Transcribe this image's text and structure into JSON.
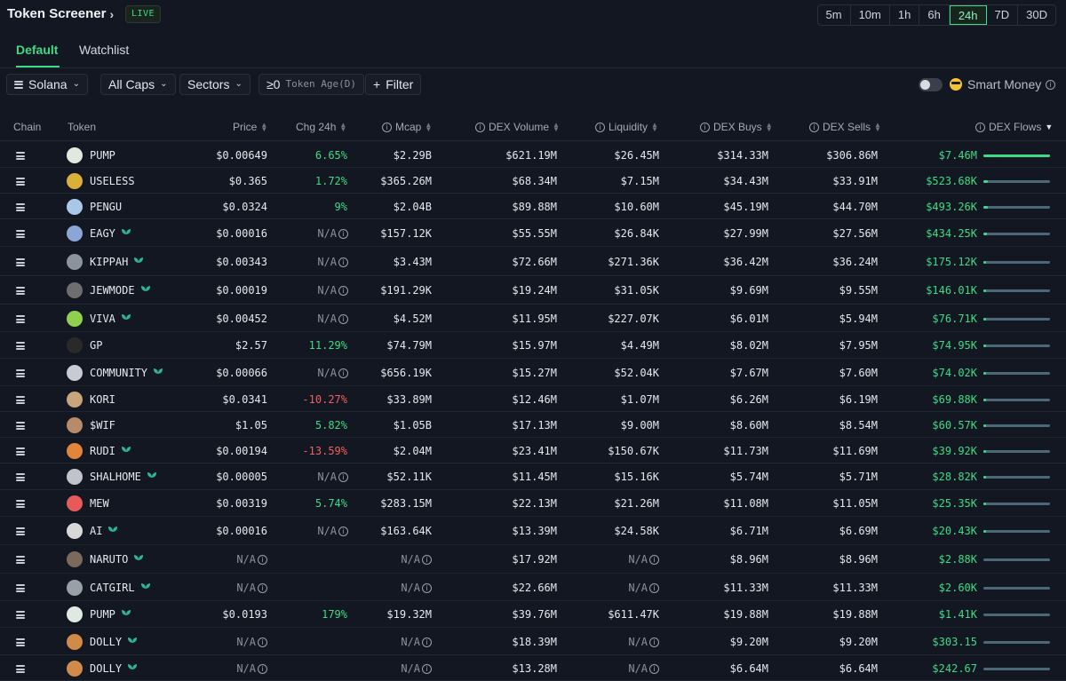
{
  "app": {
    "title": "Token Screener",
    "live_badge": "LIVE"
  },
  "timeframes": [
    "5m",
    "10m",
    "1h",
    "6h",
    "24h",
    "7D",
    "30D"
  ],
  "active_timeframe": "24h",
  "tabs": {
    "default": "Default",
    "watchlist": "Watchlist"
  },
  "filters": {
    "chain": "Solana",
    "caps": "All Caps",
    "sectors": "Sectors",
    "age_value": "≥0",
    "age_label": "Token Age(D)",
    "filter": "Filter",
    "smart_money": "Smart Money",
    "smart_money_enabled": false
  },
  "columns": {
    "chain": "Chain",
    "token": "Token",
    "price": "Price",
    "chg": "Chg 24h",
    "mcap": "Mcap",
    "volume": "DEX Volume",
    "liquidity": "Liquidity",
    "buys": "DEX Buys",
    "sells": "DEX Sells",
    "flows": "DEX Flows"
  },
  "colors": {
    "accent": "#3ddc84",
    "negative": "#f0605d",
    "background": "#131722"
  },
  "rows": [
    {
      "token": "PUMP",
      "icon_color": "#dfe9e0",
      "new": false,
      "price": "$0.00649",
      "chg": "6.65%",
      "chg_dir": "pos",
      "mcap": "$2.29B",
      "volume": "$621.19M",
      "liquidity": "$26.45M",
      "buys": "$314.33M",
      "sells": "$306.86M",
      "flows": "$7.46M",
      "flow_level": 1.0
    },
    {
      "token": "USELESS",
      "icon_color": "#d9b13a",
      "new": false,
      "price": "$0.365",
      "chg": "1.72%",
      "chg_dir": "pos",
      "mcap": "$365.26M",
      "volume": "$68.34M",
      "liquidity": "$7.15M",
      "buys": "$34.43M",
      "sells": "$33.91M",
      "flows": "$523.68K",
      "flow_level": 0.07
    },
    {
      "token": "PENGU",
      "icon_color": "#a9c7e8",
      "new": false,
      "price": "$0.0324",
      "chg": "9%",
      "chg_dir": "pos",
      "mcap": "$2.04B",
      "volume": "$89.88M",
      "liquidity": "$10.60M",
      "buys": "$45.19M",
      "sells": "$44.70M",
      "flows": "$493.26K",
      "flow_level": 0.066
    },
    {
      "token": "EAGY",
      "icon_color": "#8aa5d6",
      "new": true,
      "price": "$0.00016",
      "chg": "N/A",
      "chg_dir": "na",
      "mcap": "$157.12K",
      "volume": "$55.55M",
      "liquidity": "$26.84K",
      "buys": "$27.99M",
      "sells": "$27.56M",
      "flows": "$434.25K",
      "flow_level": 0.058
    },
    {
      "token": "KIPPAH",
      "icon_color": "#8d939c",
      "new": true,
      "price": "$0.00343",
      "chg": "N/A",
      "chg_dir": "na",
      "mcap": "$3.43M",
      "volume": "$72.66M",
      "liquidity": "$271.36K",
      "buys": "$36.42M",
      "sells": "$36.24M",
      "flows": "$175.12K",
      "flow_level": 0.023
    },
    {
      "token": "JEWMODE",
      "icon_color": "#6e6e6e",
      "new": true,
      "price": "$0.00019",
      "chg": "N/A",
      "chg_dir": "na",
      "mcap": "$191.29K",
      "volume": "$19.24M",
      "liquidity": "$31.05K",
      "buys": "$9.69M",
      "sells": "$9.55M",
      "flows": "$146.01K",
      "flow_level": 0.02
    },
    {
      "token": "VIVA",
      "icon_color": "#8fd14f",
      "new": true,
      "price": "$0.00452",
      "chg": "N/A",
      "chg_dir": "na",
      "mcap": "$4.52M",
      "volume": "$11.95M",
      "liquidity": "$227.07K",
      "buys": "$6.01M",
      "sells": "$5.94M",
      "flows": "$76.71K",
      "flow_level": 0.01
    },
    {
      "token": "GP",
      "icon_color": "#2a2a2a",
      "new": false,
      "price": "$2.57",
      "chg": "11.29%",
      "chg_dir": "pos",
      "mcap": "$74.79M",
      "volume": "$15.97M",
      "liquidity": "$4.49M",
      "buys": "$8.02M",
      "sells": "$7.95M",
      "flows": "$74.95K",
      "flow_level": 0.01
    },
    {
      "token": "COMMUNITY",
      "icon_color": "#c8ccd2",
      "new": true,
      "price": "$0.00066",
      "chg": "N/A",
      "chg_dir": "na",
      "mcap": "$656.19K",
      "volume": "$15.27M",
      "liquidity": "$52.04K",
      "buys": "$7.67M",
      "sells": "$7.60M",
      "flows": "$74.02K",
      "flow_level": 0.01
    },
    {
      "token": "KORI",
      "icon_color": "#c9a67a",
      "new": false,
      "price": "$0.0341",
      "chg": "-10.27%",
      "chg_dir": "neg",
      "mcap": "$33.89M",
      "volume": "$12.46M",
      "liquidity": "$1.07M",
      "buys": "$6.26M",
      "sells": "$6.19M",
      "flows": "$69.88K",
      "flow_level": 0.009
    },
    {
      "token": "$WIF",
      "icon_color": "#b78b6a",
      "new": false,
      "price": "$1.05",
      "chg": "5.82%",
      "chg_dir": "pos",
      "mcap": "$1.05B",
      "volume": "$17.13M",
      "liquidity": "$9.00M",
      "buys": "$8.60M",
      "sells": "$8.54M",
      "flows": "$60.57K",
      "flow_level": 0.008
    },
    {
      "token": "RUDI",
      "icon_color": "#e0853a",
      "new": true,
      "price": "$0.00194",
      "chg": "-13.59%",
      "chg_dir": "neg",
      "mcap": "$2.04M",
      "volume": "$23.41M",
      "liquidity": "$150.67K",
      "buys": "$11.73M",
      "sells": "$11.69M",
      "flows": "$39.92K",
      "flow_level": 0.005
    },
    {
      "token": "SHALHOME",
      "icon_color": "#c0c4ca",
      "new": true,
      "price": "$0.00005",
      "chg": "N/A",
      "chg_dir": "na",
      "mcap": "$52.11K",
      "volume": "$11.45M",
      "liquidity": "$15.16K",
      "buys": "$5.74M",
      "sells": "$5.71M",
      "flows": "$28.82K",
      "flow_level": 0.004
    },
    {
      "token": "MEW",
      "icon_color": "#e85a5a",
      "new": false,
      "price": "$0.00319",
      "chg": "5.74%",
      "chg_dir": "pos",
      "mcap": "$283.15M",
      "volume": "$22.13M",
      "liquidity": "$21.26M",
      "buys": "$11.08M",
      "sells": "$11.05M",
      "flows": "$25.35K",
      "flow_level": 0.003
    },
    {
      "token": "AI",
      "icon_color": "#d8d8d8",
      "new": true,
      "price": "$0.00016",
      "chg": "N/A",
      "chg_dir": "na",
      "mcap": "$163.64K",
      "volume": "$13.39M",
      "liquidity": "$24.58K",
      "buys": "$6.71M",
      "sells": "$6.69M",
      "flows": "$20.43K",
      "flow_level": 0.003
    },
    {
      "token": "NARUTO",
      "icon_color": "#7a6a5a",
      "new": true,
      "price": "N/A",
      "chg": "",
      "chg_dir": "na",
      "mcap": "N/A",
      "volume": "$17.92M",
      "liquidity": "N/A",
      "buys": "$8.96M",
      "sells": "$8.96M",
      "flows": "$2.88K",
      "flow_level": 0.0
    },
    {
      "token": "CATGIRL",
      "icon_color": "#9aa0a8",
      "new": true,
      "price": "N/A",
      "chg": "",
      "chg_dir": "na",
      "mcap": "N/A",
      "volume": "$22.66M",
      "liquidity": "N/A",
      "buys": "$11.33M",
      "sells": "$11.33M",
      "flows": "$2.60K",
      "flow_level": 0.0
    },
    {
      "token": "PUMP",
      "icon_color": "#dfe9e0",
      "new": true,
      "price": "$0.0193",
      "chg": "179%",
      "chg_dir": "pos",
      "mcap": "$19.32M",
      "volume": "$39.76M",
      "liquidity": "$611.47K",
      "buys": "$19.88M",
      "sells": "$19.88M",
      "flows": "$1.41K",
      "flow_level": 0.0
    },
    {
      "token": "DOLLY",
      "icon_color": "#d08a4a",
      "new": true,
      "price": "N/A",
      "chg": "",
      "chg_dir": "na",
      "mcap": "N/A",
      "volume": "$18.39M",
      "liquidity": "N/A",
      "buys": "$9.20M",
      "sells": "$9.20M",
      "flows": "$303.15",
      "flow_level": 0.0
    },
    {
      "token": "DOLLY",
      "icon_color": "#d08a4a",
      "new": true,
      "price": "N/A",
      "chg": "",
      "chg_dir": "na",
      "mcap": "N/A",
      "volume": "$13.28M",
      "liquidity": "N/A",
      "buys": "$6.64M",
      "sells": "$6.64M",
      "flows": "$242.67",
      "flow_level": 0.0
    }
  ]
}
